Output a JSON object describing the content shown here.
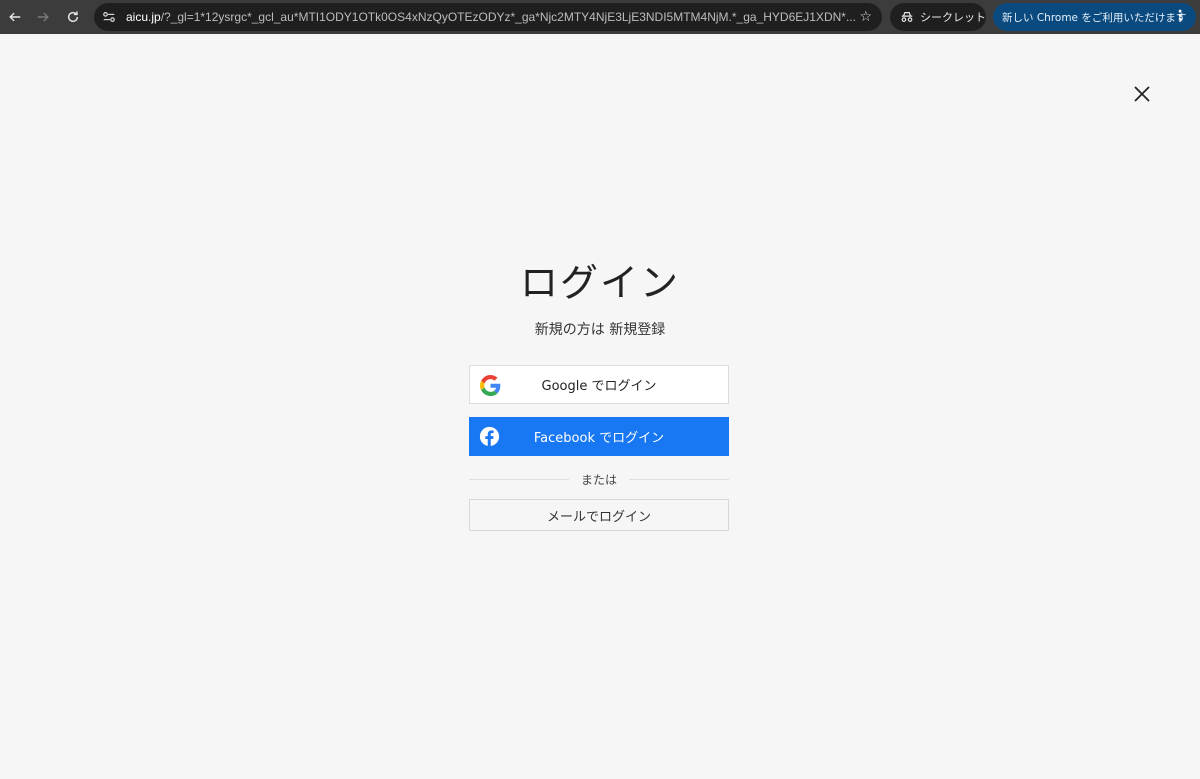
{
  "browser": {
    "url_host": "aicu.jp",
    "url_rest": "/?_gl=1*12ysrgc*_gcl_au*MTI1ODY1OTk0OS4xNzQyOTEzODYz*_ga*Njc2MTY4NjE3LjE3NDI5MTM4NjM.*_ga_HYD6EJ1XDN*...",
    "incognito_label": "シークレット",
    "update_label": "新しい Chrome をご利用いただけます"
  },
  "login": {
    "title": "ログイン",
    "signup_prefix": "新規の方は",
    "signup_link": "新規登録",
    "google_button": "Google でログイン",
    "facebook_button": "Facebook でログイン",
    "divider_label": "または",
    "email_button": "メールでログイン"
  },
  "colors": {
    "facebook_blue": "#1877f2",
    "page_background": "#f6f6f7",
    "update_pill": "#0b4a7e"
  },
  "icons": [
    "back-arrow-icon",
    "forward-arrow-icon",
    "reload-icon",
    "site-settings-icon",
    "star-icon",
    "incognito-icon",
    "kebab-menu-icon",
    "close-icon",
    "google-icon",
    "facebook-icon"
  ]
}
